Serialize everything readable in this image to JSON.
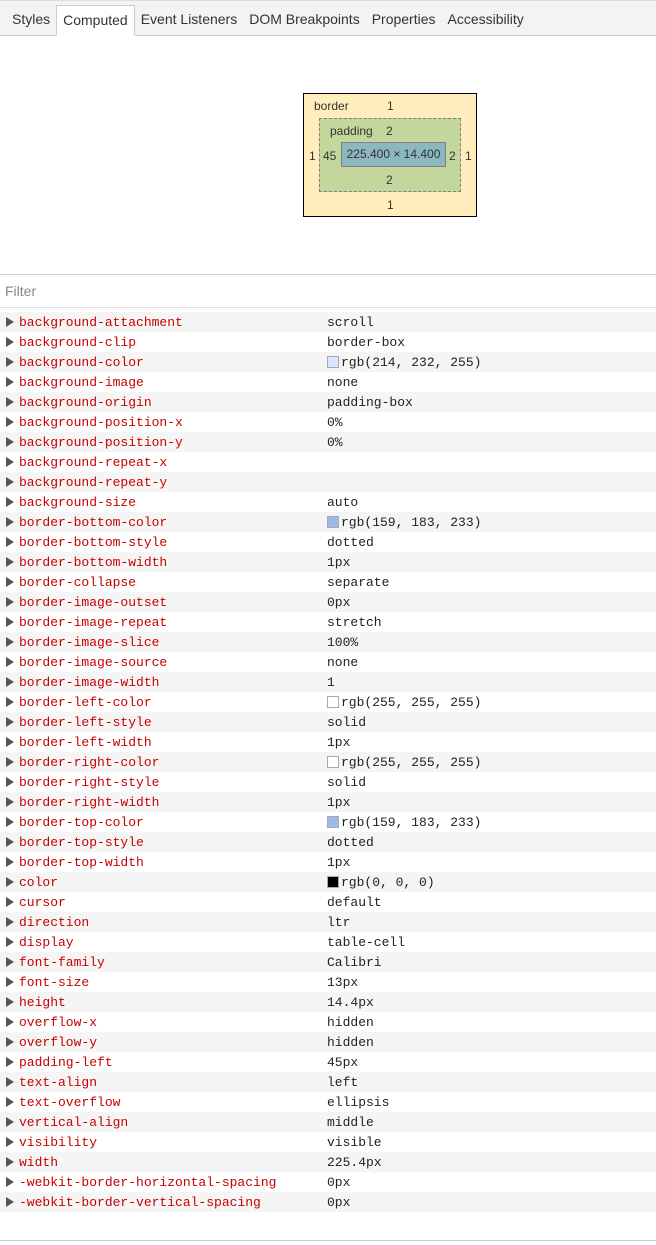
{
  "tabs": [
    "Styles",
    "Computed",
    "Event Listeners",
    "DOM Breakpoints",
    "Properties",
    "Accessibility"
  ],
  "active_tab": "Computed",
  "box_model": {
    "border_label": "border",
    "border_top": "1",
    "border_bottom": "1",
    "border_left": "1",
    "border_right": "1",
    "padding_label": "padding",
    "padding_top": "2",
    "padding_bottom": "2",
    "padding_left": "45",
    "padding_right": "2",
    "content": "225.400 × 14.400"
  },
  "filter": {
    "placeholder": "Filter",
    "value": ""
  },
  "properties": [
    {
      "name": "background-attachment",
      "value": "scroll"
    },
    {
      "name": "background-clip",
      "value": "border-box"
    },
    {
      "name": "background-color",
      "value": "rgb(214, 232, 255)",
      "swatch": "#d6e8ff"
    },
    {
      "name": "background-image",
      "value": "none"
    },
    {
      "name": "background-origin",
      "value": "padding-box"
    },
    {
      "name": "background-position-x",
      "value": "0%"
    },
    {
      "name": "background-position-y",
      "value": "0%"
    },
    {
      "name": "background-repeat-x",
      "value": ""
    },
    {
      "name": "background-repeat-y",
      "value": ""
    },
    {
      "name": "background-size",
      "value": "auto"
    },
    {
      "name": "border-bottom-color",
      "value": "rgb(159, 183, 233)",
      "swatch": "#9fb7e9"
    },
    {
      "name": "border-bottom-style",
      "value": "dotted"
    },
    {
      "name": "border-bottom-width",
      "value": "1px"
    },
    {
      "name": "border-collapse",
      "value": "separate"
    },
    {
      "name": "border-image-outset",
      "value": "0px"
    },
    {
      "name": "border-image-repeat",
      "value": "stretch"
    },
    {
      "name": "border-image-slice",
      "value": "100%"
    },
    {
      "name": "border-image-source",
      "value": "none"
    },
    {
      "name": "border-image-width",
      "value": "1"
    },
    {
      "name": "border-left-color",
      "value": "rgb(255, 255, 255)",
      "swatch": "#ffffff"
    },
    {
      "name": "border-left-style",
      "value": "solid"
    },
    {
      "name": "border-left-width",
      "value": "1px"
    },
    {
      "name": "border-right-color",
      "value": "rgb(255, 255, 255)",
      "swatch": "#ffffff"
    },
    {
      "name": "border-right-style",
      "value": "solid"
    },
    {
      "name": "border-right-width",
      "value": "1px"
    },
    {
      "name": "border-top-color",
      "value": "rgb(159, 183, 233)",
      "swatch": "#9fb7e9"
    },
    {
      "name": "border-top-style",
      "value": "dotted"
    },
    {
      "name": "border-top-width",
      "value": "1px"
    },
    {
      "name": "color",
      "value": "rgb(0, 0, 0)",
      "swatch": "#000000"
    },
    {
      "name": "cursor",
      "value": "default"
    },
    {
      "name": "direction",
      "value": "ltr"
    },
    {
      "name": "display",
      "value": "table-cell"
    },
    {
      "name": "font-family",
      "value": "Calibri"
    },
    {
      "name": "font-size",
      "value": "13px"
    },
    {
      "name": "height",
      "value": "14.4px"
    },
    {
      "name": "overflow-x",
      "value": "hidden"
    },
    {
      "name": "overflow-y",
      "value": "hidden"
    },
    {
      "name": "padding-left",
      "value": "45px"
    },
    {
      "name": "text-align",
      "value": "left"
    },
    {
      "name": "text-overflow",
      "value": "ellipsis"
    },
    {
      "name": "vertical-align",
      "value": "middle"
    },
    {
      "name": "visibility",
      "value": "visible"
    },
    {
      "name": "width",
      "value": "225.4px"
    },
    {
      "name": "-webkit-border-horizontal-spacing",
      "value": "0px"
    },
    {
      "name": "-webkit-border-vertical-spacing",
      "value": "0px"
    }
  ]
}
